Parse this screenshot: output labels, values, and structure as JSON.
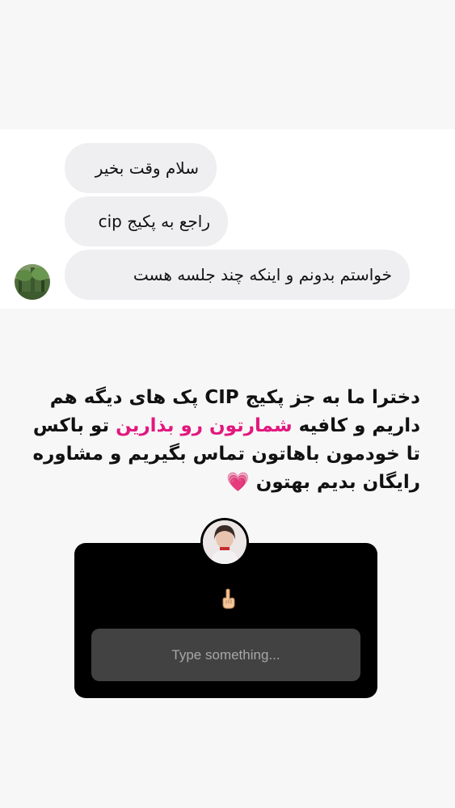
{
  "dm": {
    "messages": [
      {
        "text": "سلام وقت بخیر"
      },
      {
        "text": "راجع به پکیج cip"
      },
      {
        "text": "خواستم بدونم و اینکه چند جلسه هست"
      }
    ]
  },
  "story": {
    "part1": "دخترا ما به جز پکیج CIP پک های دیگه هم داریم و کافیه",
    "highlight": "شمارتون رو بذارین",
    "part2": "تو باکس تا خودمون باهاتون تماس بگیریم و مشاوره رایگان بدیم بهتون",
    "emoji": "💗",
    "highlight_color": "#e2187e"
  },
  "question_box": {
    "placeholder": "Type something...",
    "pointer_icon": "pointing-down-hand-icon"
  }
}
